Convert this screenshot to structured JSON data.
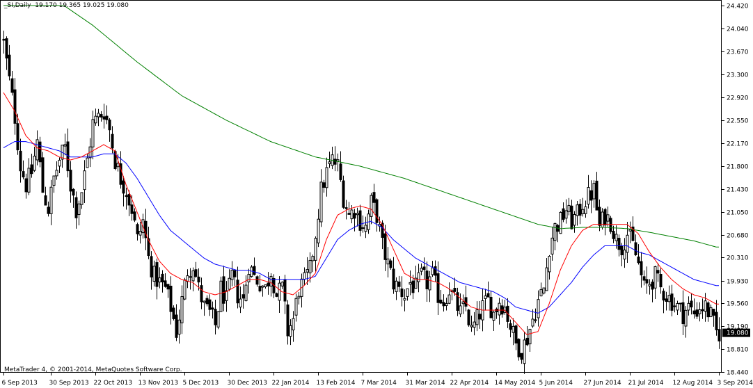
{
  "header": {
    "symbol": "_SI,Daily",
    "ohlc": "19.170 19.365 19.025 19.080"
  },
  "footer": {
    "copyright": "MetaTrader 4, © 2001-2014, MetaQuotes Software Corp."
  },
  "colors": {
    "background": "#ffffff",
    "candle": "#000000",
    "ma_fast": "#ff0000",
    "ma_mid": "#0000ff",
    "ma_slow": "#008000",
    "current_price_bg": "#000000",
    "current_price_text": "#ffffff"
  },
  "chart_data": {
    "type": "candlestick",
    "symbol": "_SI",
    "timeframe": "Daily",
    "current_price": "19.080",
    "ylim": [
      18.44,
      24.42
    ],
    "y_ticks": [
      "24.420",
      "24.040",
      "23.670",
      "23.300",
      "22.920",
      "22.550",
      "22.170",
      "21.800",
      "21.430",
      "21.050",
      "20.680",
      "20.310",
      "19.930",
      "19.560",
      "19.190",
      "18.810",
      "18.440"
    ],
    "x_ticks": [
      {
        "label": "6 Sep 2013",
        "i": 0
      },
      {
        "label": "30 Sep 2013",
        "i": 17
      },
      {
        "label": "22 Oct 2013",
        "i": 33
      },
      {
        "label": "13 Nov 2013",
        "i": 49
      },
      {
        "label": "5 Dec 2013",
        "i": 65
      },
      {
        "label": "30 Dec 2013",
        "i": 81
      },
      {
        "label": "22 Jan 2014",
        "i": 97
      },
      {
        "label": "13 Feb 2014",
        "i": 113
      },
      {
        "label": "7 Mar 2014",
        "i": 129
      },
      {
        "label": "31 Mar 2014",
        "i": 145
      },
      {
        "label": "22 Apr 2014",
        "i": 161
      },
      {
        "label": "14 May 2014",
        "i": 177
      },
      {
        "label": "5 Jun 2014",
        "i": 193
      },
      {
        "label": "27 Jun 2014",
        "i": 209
      },
      {
        "label": "21 Jul 2014",
        "i": 225
      },
      {
        "label": "12 Aug 2014",
        "i": 241
      },
      {
        "label": "3 Sep 2014",
        "i": 257
      }
    ],
    "close_anchors": [
      [
        0,
        23.8
      ],
      [
        2,
        23.2
      ],
      [
        4,
        22.6
      ],
      [
        6,
        21.8
      ],
      [
        8,
        21.5
      ],
      [
        10,
        21.7
      ],
      [
        12,
        22.2
      ],
      [
        14,
        21.4
      ],
      [
        16,
        21.1
      ],
      [
        18,
        21.6
      ],
      [
        20,
        21.9
      ],
      [
        22,
        22.1
      ],
      [
        24,
        21.5
      ],
      [
        26,
        21.1
      ],
      [
        28,
        21.4
      ],
      [
        30,
        21.9
      ],
      [
        32,
        22.5
      ],
      [
        34,
        22.6
      ],
      [
        36,
        22.7
      ],
      [
        38,
        22.4
      ],
      [
        40,
        21.9
      ],
      [
        42,
        21.6
      ],
      [
        44,
        21.4
      ],
      [
        46,
        21.1
      ],
      [
        48,
        20.6
      ],
      [
        50,
        20.9
      ],
      [
        52,
        20.3
      ],
      [
        54,
        20.0
      ],
      [
        56,
        19.9
      ],
      [
        58,
        19.8
      ],
      [
        60,
        19.5
      ],
      [
        62,
        19.1
      ],
      [
        64,
        19.6
      ],
      [
        66,
        20.1
      ],
      [
        68,
        20.2
      ],
      [
        70,
        19.8
      ],
      [
        72,
        19.5
      ],
      [
        74,
        19.4
      ],
      [
        76,
        19.2
      ],
      [
        78,
        19.8
      ],
      [
        80,
        19.6
      ],
      [
        82,
        20.0
      ],
      [
        84,
        19.7
      ],
      [
        86,
        19.6
      ],
      [
        88,
        20.2
      ],
      [
        90,
        20.0
      ],
      [
        92,
        19.9
      ],
      [
        94,
        19.8
      ],
      [
        96,
        20.1
      ],
      [
        98,
        19.7
      ],
      [
        100,
        19.8
      ],
      [
        102,
        19.1
      ],
      [
        104,
        19.3
      ],
      [
        106,
        19.8
      ],
      [
        108,
        19.9
      ],
      [
        110,
        20.1
      ],
      [
        112,
        20.7
      ],
      [
        114,
        21.4
      ],
      [
        116,
        21.7
      ],
      [
        118,
        21.9
      ],
      [
        120,
        21.8
      ],
      [
        122,
        21.3
      ],
      [
        124,
        21.0
      ],
      [
        126,
        21.1
      ],
      [
        128,
        20.9
      ],
      [
        130,
        20.8
      ],
      [
        132,
        21.2
      ],
      [
        134,
        21.0
      ],
      [
        136,
        20.5
      ],
      [
        138,
        20.2
      ],
      [
        140,
        19.9
      ],
      [
        142,
        19.8
      ],
      [
        144,
        19.7
      ],
      [
        146,
        19.9
      ],
      [
        148,
        19.8
      ],
      [
        150,
        20.0
      ],
      [
        152,
        19.9
      ],
      [
        154,
        20.0
      ],
      [
        156,
        19.7
      ],
      [
        158,
        19.6
      ],
      [
        160,
        19.8
      ],
      [
        162,
        19.6
      ],
      [
        164,
        19.4
      ],
      [
        166,
        19.5
      ],
      [
        168,
        19.1
      ],
      [
        170,
        19.3
      ],
      [
        172,
        19.5
      ],
      [
        174,
        19.6
      ],
      [
        176,
        19.4
      ],
      [
        178,
        19.6
      ],
      [
        180,
        19.5
      ],
      [
        182,
        19.2
      ],
      [
        184,
        18.9
      ],
      [
        186,
        18.8
      ],
      [
        188,
        19.0
      ],
      [
        190,
        19.3
      ],
      [
        192,
        19.6
      ],
      [
        194,
        19.8
      ],
      [
        196,
        20.5
      ],
      [
        198,
        20.8
      ],
      [
        200,
        20.9
      ],
      [
        202,
        21.1
      ],
      [
        204,
        20.9
      ],
      [
        206,
        21.0
      ],
      [
        208,
        21.2
      ],
      [
        210,
        21.3
      ],
      [
        212,
        21.4
      ],
      [
        214,
        20.8
      ],
      [
        216,
        21.0
      ],
      [
        218,
        20.9
      ],
      [
        220,
        20.6
      ],
      [
        222,
        20.5
      ],
      [
        224,
        20.7
      ],
      [
        226,
        20.5
      ],
      [
        228,
        20.2
      ],
      [
        230,
        19.8
      ],
      [
        232,
        19.9
      ],
      [
        234,
        20.0
      ],
      [
        236,
        19.8
      ],
      [
        238,
        19.7
      ],
      [
        240,
        19.6
      ],
      [
        242,
        19.5
      ],
      [
        244,
        19.4
      ],
      [
        246,
        19.5
      ],
      [
        248,
        19.4
      ],
      [
        250,
        19.5
      ],
      [
        252,
        19.5
      ],
      [
        254,
        19.35
      ],
      [
        256,
        19.08
      ]
    ],
    "ma_fast_anchors": [
      [
        0,
        23.0
      ],
      [
        4,
        22.7
      ],
      [
        8,
        22.3
      ],
      [
        12,
        22.1
      ],
      [
        16,
        22.05
      ],
      [
        20,
        21.95
      ],
      [
        24,
        21.9
      ],
      [
        28,
        21.95
      ],
      [
        32,
        22.05
      ],
      [
        36,
        22.15
      ],
      [
        40,
        22.05
      ],
      [
        44,
        21.5
      ],
      [
        48,
        21.05
      ],
      [
        52,
        20.6
      ],
      [
        56,
        20.25
      ],
      [
        60,
        20.05
      ],
      [
        64,
        19.95
      ],
      [
        68,
        19.9
      ],
      [
        72,
        19.75
      ],
      [
        76,
        19.7
      ],
      [
        80,
        19.75
      ],
      [
        84,
        19.85
      ],
      [
        88,
        19.95
      ],
      [
        92,
        19.95
      ],
      [
        96,
        19.9
      ],
      [
        100,
        19.75
      ],
      [
        104,
        19.7
      ],
      [
        108,
        19.85
      ],
      [
        112,
        20.05
      ],
      [
        116,
        20.6
      ],
      [
        120,
        21.0
      ],
      [
        124,
        21.1
      ],
      [
        128,
        21.15
      ],
      [
        132,
        21.1
      ],
      [
        136,
        20.85
      ],
      [
        140,
        20.45
      ],
      [
        144,
        20.05
      ],
      [
        148,
        19.95
      ],
      [
        152,
        19.95
      ],
      [
        156,
        19.9
      ],
      [
        160,
        19.8
      ],
      [
        164,
        19.65
      ],
      [
        168,
        19.5
      ],
      [
        172,
        19.45
      ],
      [
        176,
        19.45
      ],
      [
        180,
        19.45
      ],
      [
        184,
        19.25
      ],
      [
        188,
        19.05
      ],
      [
        192,
        19.1
      ],
      [
        196,
        19.55
      ],
      [
        200,
        20.1
      ],
      [
        204,
        20.5
      ],
      [
        208,
        20.75
      ],
      [
        212,
        20.85
      ],
      [
        216,
        20.85
      ],
      [
        220,
        20.85
      ],
      [
        224,
        20.85
      ],
      [
        228,
        20.7
      ],
      [
        232,
        20.4
      ],
      [
        236,
        20.15
      ],
      [
        240,
        19.95
      ],
      [
        244,
        19.8
      ],
      [
        248,
        19.7
      ],
      [
        252,
        19.65
      ],
      [
        256,
        19.55
      ]
    ],
    "ma_mid_anchors": [
      [
        0,
        22.1
      ],
      [
        4,
        22.2
      ],
      [
        8,
        22.2
      ],
      [
        12,
        22.15
      ],
      [
        16,
        22.1
      ],
      [
        20,
        22.05
      ],
      [
        24,
        21.95
      ],
      [
        28,
        21.95
      ],
      [
        32,
        21.95
      ],
      [
        36,
        22.0
      ],
      [
        40,
        22.0
      ],
      [
        44,
        21.85
      ],
      [
        48,
        21.6
      ],
      [
        52,
        21.3
      ],
      [
        56,
        21.0
      ],
      [
        60,
        20.75
      ],
      [
        64,
        20.6
      ],
      [
        68,
        20.45
      ],
      [
        72,
        20.3
      ],
      [
        76,
        20.2
      ],
      [
        80,
        20.15
      ],
      [
        84,
        20.1
      ],
      [
        88,
        20.1
      ],
      [
        92,
        20.05
      ],
      [
        96,
        19.95
      ],
      [
        100,
        19.95
      ],
      [
        104,
        19.95
      ],
      [
        108,
        19.95
      ],
      [
        112,
        20.0
      ],
      [
        116,
        20.3
      ],
      [
        120,
        20.6
      ],
      [
        124,
        20.75
      ],
      [
        128,
        20.85
      ],
      [
        132,
        20.9
      ],
      [
        136,
        20.8
      ],
      [
        140,
        20.6
      ],
      [
        144,
        20.45
      ],
      [
        148,
        20.3
      ],
      [
        152,
        20.2
      ],
      [
        156,
        20.1
      ],
      [
        160,
        20.0
      ],
      [
        164,
        19.9
      ],
      [
        168,
        19.85
      ],
      [
        172,
        19.8
      ],
      [
        176,
        19.75
      ],
      [
        180,
        19.65
      ],
      [
        184,
        19.5
      ],
      [
        188,
        19.45
      ],
      [
        192,
        19.4
      ],
      [
        196,
        19.5
      ],
      [
        200,
        19.7
      ],
      [
        204,
        19.9
      ],
      [
        208,
        20.15
      ],
      [
        212,
        20.35
      ],
      [
        216,
        20.5
      ],
      [
        220,
        20.5
      ],
      [
        224,
        20.5
      ],
      [
        228,
        20.4
      ],
      [
        232,
        20.35
      ],
      [
        236,
        20.25
      ],
      [
        240,
        20.15
      ],
      [
        244,
        20.05
      ],
      [
        248,
        19.95
      ],
      [
        252,
        19.9
      ],
      [
        256,
        19.85
      ]
    ],
    "ma_slow_anchors": [
      [
        0,
        24.8
      ],
      [
        16,
        24.6
      ],
      [
        32,
        24.1
      ],
      [
        48,
        23.5
      ],
      [
        64,
        22.95
      ],
      [
        80,
        22.55
      ],
      [
        96,
        22.2
      ],
      [
        112,
        21.95
      ],
      [
        128,
        21.8
      ],
      [
        144,
        21.6
      ],
      [
        160,
        21.35
      ],
      [
        176,
        21.1
      ],
      [
        192,
        20.85
      ],
      [
        200,
        20.78
      ],
      [
        208,
        20.8
      ],
      [
        216,
        20.8
      ],
      [
        224,
        20.78
      ],
      [
        232,
        20.72
      ],
      [
        240,
        20.65
      ],
      [
        248,
        20.58
      ],
      [
        256,
        20.48
      ]
    ]
  }
}
